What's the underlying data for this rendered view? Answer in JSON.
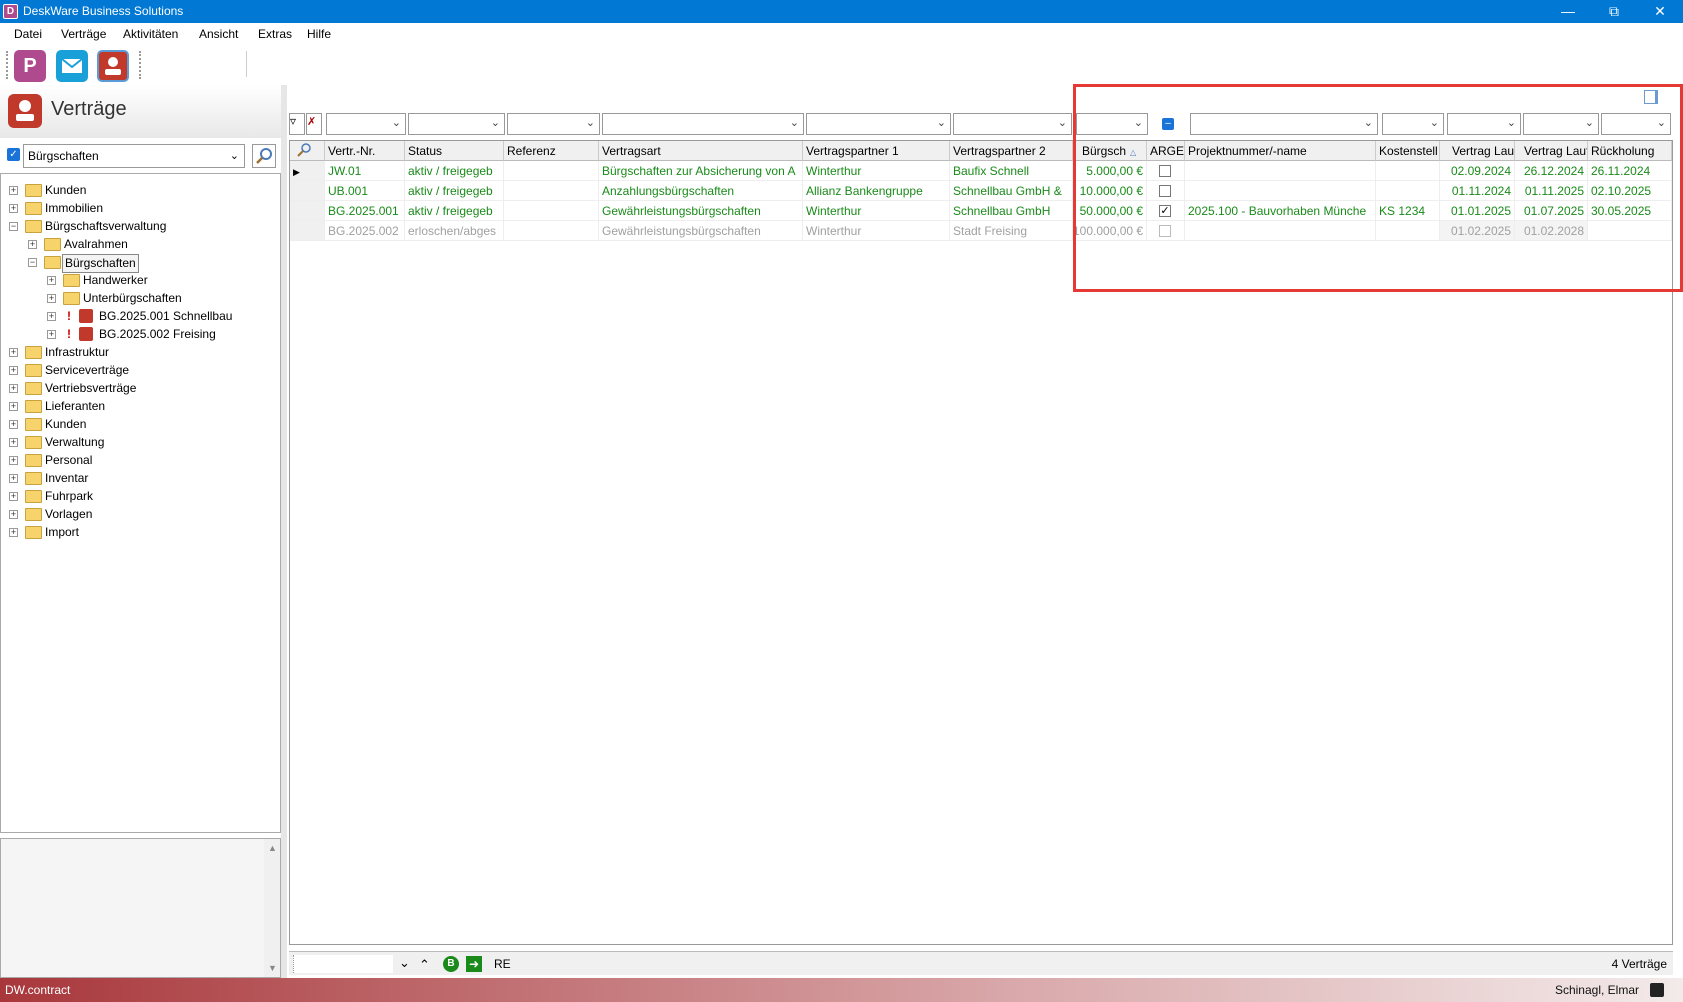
{
  "window": {
    "title": "DeskWare Business Solutions"
  },
  "menu": [
    "Datei",
    "Verträge",
    "Aktivitäten",
    "Ansicht",
    "Extras",
    "Hilfe"
  ],
  "toolbar": {
    "buttons": [
      "P",
      "mail",
      "contracts"
    ]
  },
  "left": {
    "title": "Verträge",
    "filter_value": "Bürgschaften",
    "tree": [
      {
        "label": "Kunden",
        "level": 0,
        "type": "folder"
      },
      {
        "label": "Immobilien",
        "level": 0,
        "type": "folder"
      },
      {
        "label": "Bürgschaftsverwaltung",
        "level": 0,
        "type": "folder",
        "expanded": true
      },
      {
        "label": "Avalrahmen",
        "level": 1,
        "type": "folder"
      },
      {
        "label": "Bürgschaften",
        "level": 1,
        "type": "folder",
        "expanded": true,
        "selected": true
      },
      {
        "label": "Handwerker",
        "level": 2,
        "type": "folder"
      },
      {
        "label": "Unterbürgschaften",
        "level": 2,
        "type": "folder"
      },
      {
        "label": "BG.2025.001 Schnellbau",
        "level": 2,
        "type": "contract"
      },
      {
        "label": "BG.2025.002 Freising",
        "level": 2,
        "type": "contract"
      },
      {
        "label": "Infrastruktur",
        "level": 0,
        "type": "folder"
      },
      {
        "label": "Serviceverträge",
        "level": 0,
        "type": "folder"
      },
      {
        "label": "Vertriebsverträge",
        "level": 0,
        "type": "folder"
      },
      {
        "label": "Lieferanten",
        "level": 0,
        "type": "folder"
      },
      {
        "label": "Kunden",
        "level": 0,
        "type": "folder"
      },
      {
        "label": "Verwaltung",
        "level": 0,
        "type": "folder"
      },
      {
        "label": "Personal",
        "level": 0,
        "type": "folder"
      },
      {
        "label": "Inventar",
        "level": 0,
        "type": "folder"
      },
      {
        "label": "Fuhrpark",
        "level": 0,
        "type": "folder"
      },
      {
        "label": "Vorlagen",
        "level": 0,
        "type": "folder"
      },
      {
        "label": "Import",
        "level": 0,
        "type": "folder"
      }
    ]
  },
  "grid": {
    "headers": [
      "Vertr.-Nr.",
      "Status",
      "Referenz",
      "Vertragsart",
      "Vertragspartner 1",
      "Vertragspartner 2",
      "Bürgsch",
      "ARGE",
      "Projektnummer/-name",
      "Kostenstell",
      "Vertrag Lauf",
      "Vertrag Laufz",
      "Rückholung"
    ],
    "rows": [
      {
        "nr": "JW.01",
        "status": "aktiv / freigegeb",
        "ref": "",
        "art": "Bürgschaften zur Absicherung von A",
        "p1": "Winterthur",
        "p2": "Baufix Schnell",
        "amount": "5.000,00 €",
        "arge": false,
        "projekt": "",
        "kst": "",
        "lauf": "02.09.2024",
        "laufz": "26.12.2024",
        "rueck": "26.11.2024",
        "style": "green"
      },
      {
        "nr": "UB.001",
        "status": "aktiv / freigegeb",
        "ref": "",
        "art": "Anzahlungsbürgschaften",
        "p1": "Allianz Bankengruppe",
        "p2": "Schnellbau GmbH &",
        "amount": "10.000,00 €",
        "arge": false,
        "projekt": "",
        "kst": "",
        "lauf": "01.11.2024",
        "laufz": "01.11.2025",
        "rueck": "02.10.2025",
        "style": "green"
      },
      {
        "nr": "BG.2025.001",
        "status": "aktiv / freigegeb",
        "ref": "",
        "art": "Gewährleistungsbürgschaften",
        "p1": "Winterthur",
        "p2": "Schnellbau GmbH",
        "amount": "50.000,00 €",
        "arge": true,
        "projekt": "2025.100 - Bauvorhaben Münche",
        "kst": "KS 1234",
        "lauf": "01.01.2025",
        "laufz": "01.07.2025",
        "rueck": "30.05.2025",
        "style": "green"
      },
      {
        "nr": "BG.2025.002",
        "status": "erloschen/abges",
        "ref": "",
        "art": "Gewährleistungsbürgschaften",
        "p1": "Winterthur",
        "p2": "Stadt Freising",
        "amount": "100.000,00 €",
        "arge": false,
        "projekt": "",
        "kst": "",
        "lauf": "01.02.2025",
        "laufz": "01.02.2028",
        "rueck": "",
        "style": "gray"
      }
    ]
  },
  "footer": {
    "search_value": "",
    "re_label": "RE",
    "count": "4 Verträge"
  },
  "status": {
    "app": "DW.contract",
    "user": "Schinagl, Elmar"
  },
  "colors": {
    "titlebar": "#0078d4",
    "active_text": "#1a8a1a",
    "inactive_text": "#a0a0a0",
    "highlight": "#e53935"
  }
}
